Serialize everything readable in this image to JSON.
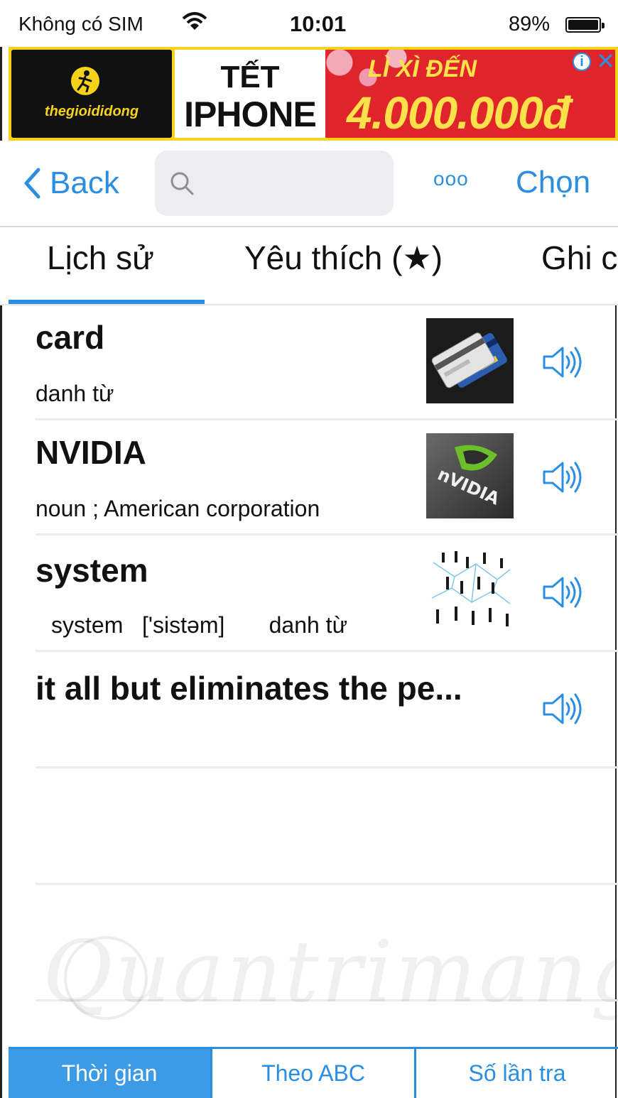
{
  "status_bar": {
    "carrier": "Không có SIM",
    "time": "10:01",
    "battery": "89%",
    "wifi_icon": "wifi-icon",
    "battery_icon": "battery-icon"
  },
  "ad": {
    "brand": "thegioididong",
    "headline_1": "TẾT",
    "headline_2": "IPHONE",
    "promo_1": "LÌ XÌ ĐẾN",
    "promo_2": "4.000.000đ",
    "adchoices_icon": "info-icon",
    "close_icon": "close-icon",
    "colors": {
      "yellow": "#f7d21a",
      "red": "#e0242b"
    }
  },
  "nav": {
    "back_label": "Back",
    "search_placeholder": "",
    "more_label": "ooo",
    "select_label": "Chọn"
  },
  "tabs": [
    {
      "label": "Lịch sử",
      "active": true
    },
    {
      "label": "Yêu thích (★)",
      "active": false
    },
    {
      "label": "Ghi c",
      "active": false
    }
  ],
  "entries": [
    {
      "word": "card",
      "description": "danh từ",
      "thumbnail": "credit-card-image"
    },
    {
      "word": "NVIDIA",
      "description": "noun ; American corporation",
      "thumbnail": "nvidia-logo-image"
    },
    {
      "word": "system",
      "description": "system   ['sistəm]       danh từ",
      "thumbnail": "network-people-image"
    },
    {
      "word": "it all but eliminates the pe...",
      "description": "",
      "thumbnail": ""
    }
  ],
  "watermark": "Quantrimang",
  "sort_options": [
    {
      "label": "Thời gian",
      "active": true
    },
    {
      "label": "Theo ABC",
      "active": false
    },
    {
      "label": "Số lần tra",
      "active": false
    }
  ],
  "accent_color": "#2b8ee0"
}
